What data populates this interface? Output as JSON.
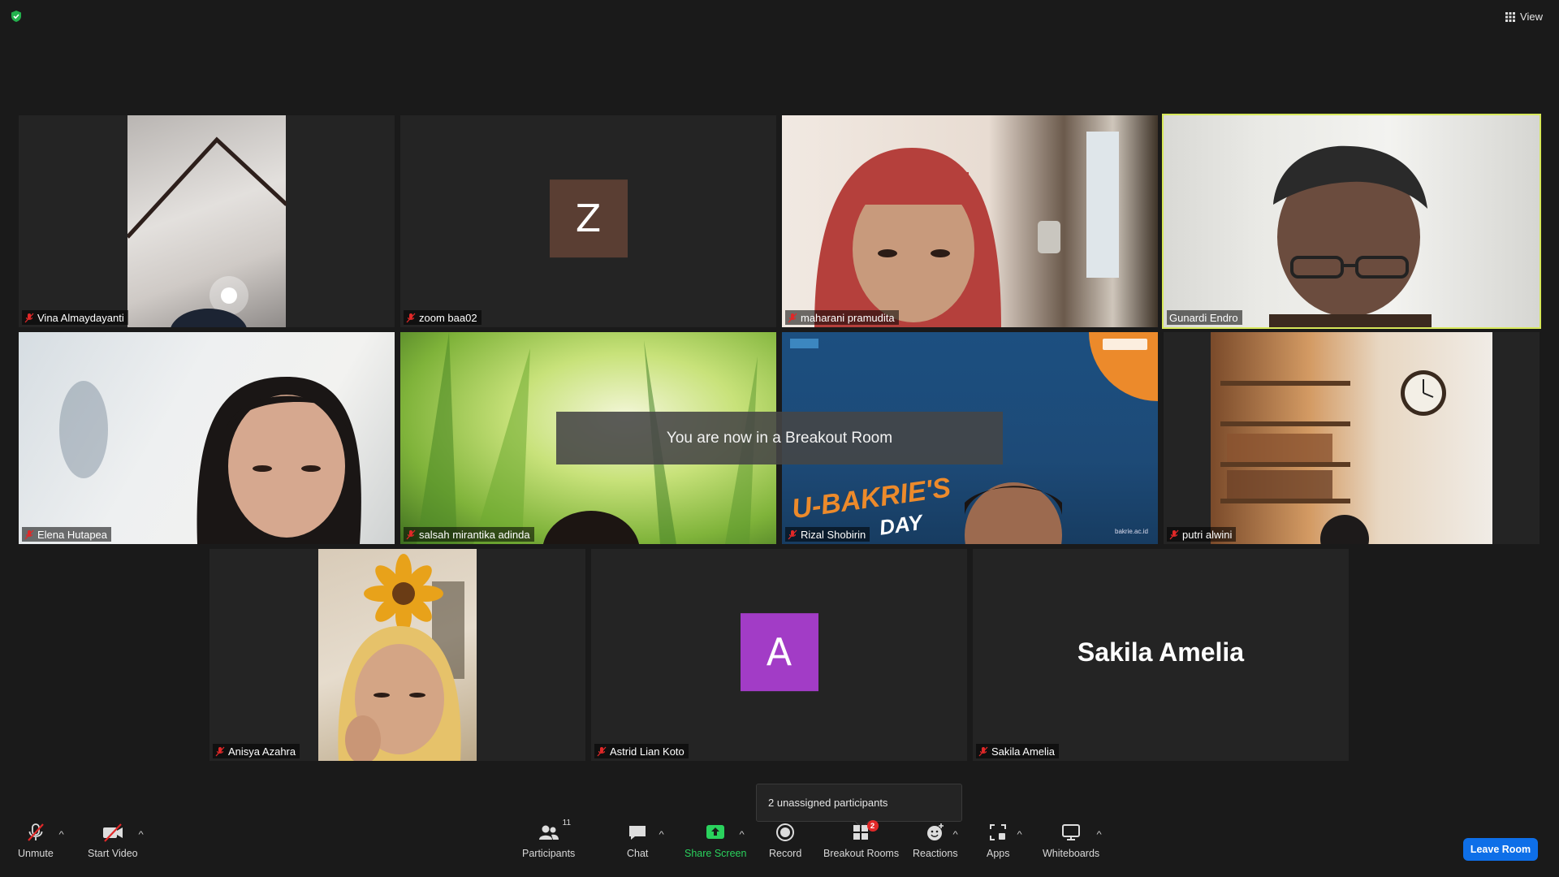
{
  "header": {
    "view_label": "View"
  },
  "participants": [
    {
      "name": "Vina Almaydayanti",
      "muted": true
    },
    {
      "name": "zoom baa02",
      "muted": true,
      "avatar_letter": "Z",
      "avatar_color": "#5a3e33"
    },
    {
      "name": "maharani pramudita",
      "muted": true
    },
    {
      "name": "Gunardi Endro",
      "muted": false,
      "active_speaker": true
    },
    {
      "name": "Elena Hutapea",
      "muted": true
    },
    {
      "name": "salsah mirantika adinda",
      "muted": true
    },
    {
      "name": "Rizal Shobirin",
      "muted": true
    },
    {
      "name": "putri alwini",
      "muted": true
    },
    {
      "name": "Anisya Azahra",
      "muted": true
    },
    {
      "name": "Astrid Lian Koto",
      "muted": true,
      "avatar_letter": "A",
      "avatar_color": "#a23cc6"
    },
    {
      "name": "Sakila Amelia",
      "muted": true,
      "display_text": "Sakila Amelia"
    }
  ],
  "toast": {
    "message": "You are now in a Breakout Room"
  },
  "unassigned": {
    "text": "2 unassigned participants"
  },
  "toolbar": {
    "unmute": "Unmute",
    "start_video": "Start Video",
    "participants": "Participants",
    "participants_count": "11",
    "chat": "Chat",
    "share_screen": "Share Screen",
    "record": "Record",
    "breakout_rooms": "Breakout Rooms",
    "breakout_badge": "2",
    "reactions": "Reactions",
    "apps": "Apps",
    "whiteboards": "Whiteboards",
    "leave": "Leave Room"
  },
  "colors": {
    "active_speaker_border": "#d7e85a",
    "leave_button": "#0e6fe8",
    "share_green": "#2ad25d",
    "mute_red": "#e02828"
  }
}
